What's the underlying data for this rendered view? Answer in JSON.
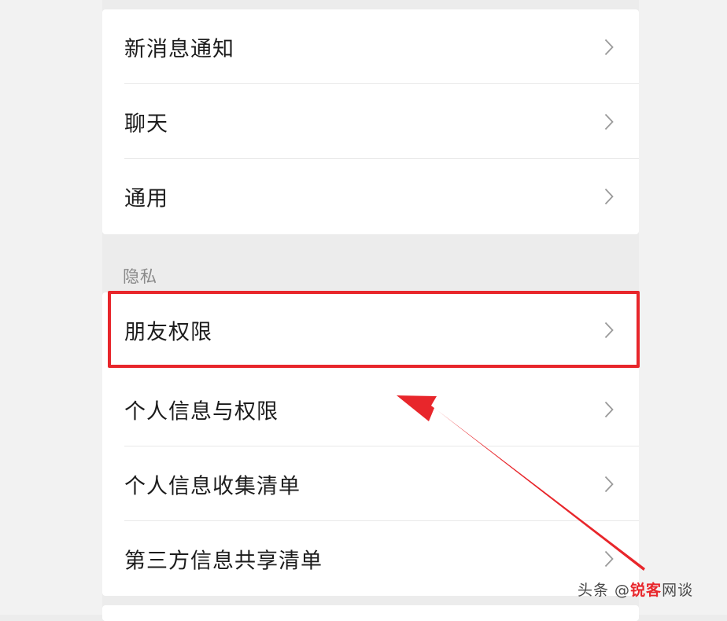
{
  "settings": {
    "general_group": [
      {
        "label": "新消息通知"
      },
      {
        "label": "聊天"
      },
      {
        "label": "通用"
      }
    ],
    "privacy_header": "隐私",
    "privacy_group": [
      {
        "label": "朋友权限"
      },
      {
        "label": "个人信息与权限"
      },
      {
        "label": "个人信息收集清单"
      },
      {
        "label": "第三方信息共享清单"
      }
    ]
  },
  "annotation": {
    "highlight_color": "#e8262b",
    "highlighted_item": "朋友权限"
  },
  "watermark": {
    "prefix": "头条 @",
    "highlight": "锐客",
    "suffix": "网谈"
  }
}
